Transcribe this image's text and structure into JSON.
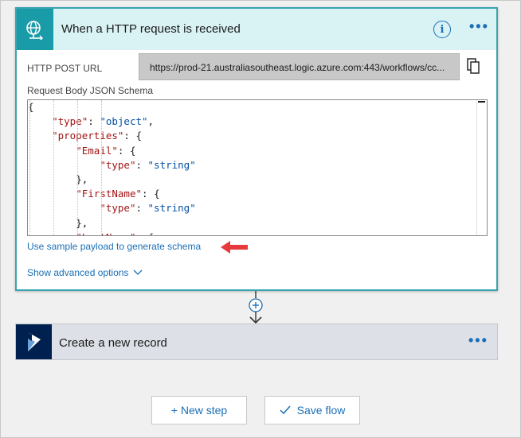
{
  "trigger": {
    "title": "When a HTTP request is received",
    "icon": "globe-request-icon",
    "info_icon_label": "i",
    "more_label": "•••",
    "url_label": "HTTP POST URL",
    "url_value": "https://prod-21.australiasoutheast.logic.azure.com:443/workflows/cc...",
    "schema_label": "Request Body JSON Schema",
    "schema_lines": [
      {
        "indent": "",
        "parts": [
          {
            "t": "p",
            "v": "{"
          }
        ]
      },
      {
        "indent": "    ",
        "parts": [
          {
            "t": "k",
            "v": "\"type\""
          },
          {
            "t": "p",
            "v": ": "
          },
          {
            "t": "s",
            "v": "\"object\""
          },
          {
            "t": "p",
            "v": ","
          }
        ]
      },
      {
        "indent": "    ",
        "parts": [
          {
            "t": "k",
            "v": "\"properties\""
          },
          {
            "t": "p",
            "v": ": {"
          }
        ]
      },
      {
        "indent": "        ",
        "parts": [
          {
            "t": "k",
            "v": "\"Email\""
          },
          {
            "t": "p",
            "v": ": {"
          }
        ]
      },
      {
        "indent": "            ",
        "parts": [
          {
            "t": "k",
            "v": "\"type\""
          },
          {
            "t": "p",
            "v": ": "
          },
          {
            "t": "s",
            "v": "\"string\""
          }
        ]
      },
      {
        "indent": "        ",
        "parts": [
          {
            "t": "p",
            "v": "},"
          }
        ]
      },
      {
        "indent": "        ",
        "parts": [
          {
            "t": "k",
            "v": "\"FirstName\""
          },
          {
            "t": "p",
            "v": ": {"
          }
        ]
      },
      {
        "indent": "            ",
        "parts": [
          {
            "t": "k",
            "v": "\"type\""
          },
          {
            "t": "p",
            "v": ": "
          },
          {
            "t": "s",
            "v": "\"string\""
          }
        ]
      },
      {
        "indent": "        ",
        "parts": [
          {
            "t": "p",
            "v": "},"
          }
        ]
      },
      {
        "indent": "        ",
        "parts": [
          {
            "t": "k",
            "v": "\"LastName\""
          },
          {
            "t": "p",
            "v": ": {"
          }
        ]
      }
    ],
    "sample_link": "Use sample payload to generate schema",
    "advanced_link": "Show advanced options"
  },
  "action": {
    "title": "Create a new record",
    "icon": "dynamics-icon",
    "more_label": "•••"
  },
  "buttons": {
    "new_step": "+ New step",
    "save_flow": "Save flow"
  },
  "colors": {
    "accent": "#1a6fb6",
    "trigger_header_bg": "#d9f2f4",
    "trigger_icon_bg": "#1a9ba8",
    "dynamics_bg": "#002050",
    "annotation_arrow": "#e8393c"
  }
}
